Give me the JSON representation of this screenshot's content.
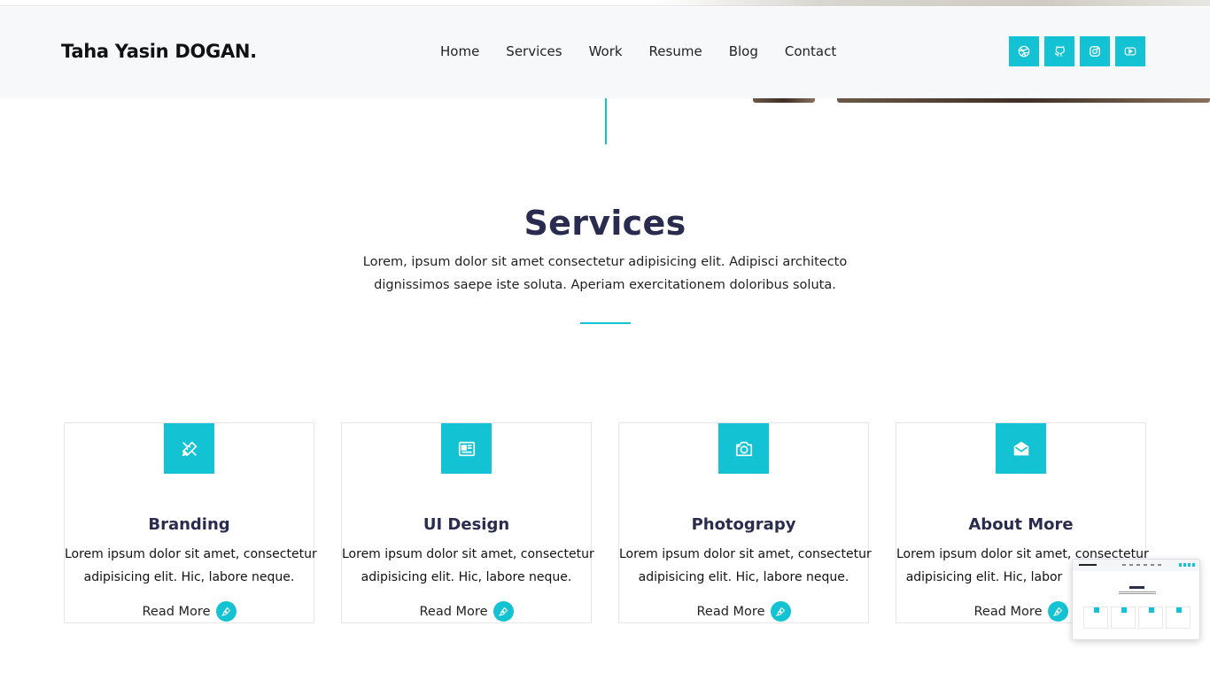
{
  "header": {
    "brand": "Taha Yasin DOGAN.",
    "nav": [
      "Home",
      "Services",
      "Work",
      "Resume",
      "Blog",
      "Contact"
    ],
    "social": [
      {
        "icon": "dribbble-icon"
      },
      {
        "icon": "github-icon"
      },
      {
        "icon": "instagram-icon"
      },
      {
        "icon": "youtube-icon"
      }
    ]
  },
  "services": {
    "title": "Services",
    "description": "Lorem, ipsum dolor sit amet consectetur adipisicing elit. Adipisci architecto dignissimos saepe iste soluta. Aperiam exercitationem doloribus soluta.",
    "cards": [
      {
        "icon": "design-tools-icon",
        "title": "Branding",
        "text1": "Lorem ipsum dolor sit amet, consectetur",
        "text2": "adipisicing elit. Hic, labore neque.",
        "link": "Read More"
      },
      {
        "icon": "newspaper-icon",
        "title": "UI Design",
        "text1": "Lorem ipsum dolor sit amet, consectetur",
        "text2": "adipisicing elit. Hic, labore neque.",
        "link": "Read More"
      },
      {
        "icon": "camera-icon",
        "title": "Photograpy",
        "text1": "Lorem ipsum dolor sit amet, consectetur",
        "text2": "adipisicing elit. Hic, labore neque.",
        "link": "Read More"
      },
      {
        "icon": "mail-open-icon",
        "title": "About More",
        "text1": "Lorem ipsum dolor sit amet, consectetur",
        "text2": "adipisicing elit. Hic, labor",
        "link": "Read More"
      }
    ]
  },
  "colors": {
    "accent": "#13c3d3",
    "heading": "#2a2c4f",
    "header_bg": "#f7f8fa"
  }
}
